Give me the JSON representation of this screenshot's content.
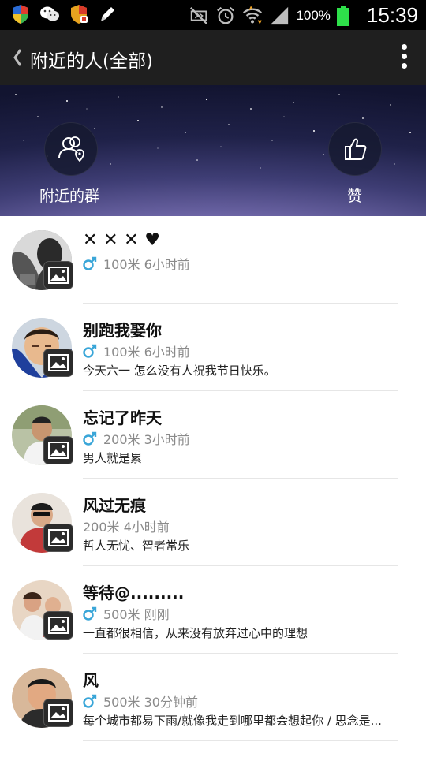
{
  "status_bar": {
    "battery_text": "100%",
    "time": "15:39",
    "left_icons": [
      "shield-icon",
      "wechat-icon",
      "shield-badge-icon",
      "pen-icon"
    ],
    "right_icons": [
      "mute-icon",
      "alarm-icon",
      "wifi-icon",
      "signal-icon",
      "battery-icon"
    ]
  },
  "action_bar": {
    "title": "附近的人(全部)"
  },
  "banner": {
    "left_button_label": "附近的群",
    "right_button_label": "赞"
  },
  "people": [
    {
      "name": "✕ ✕ ✕ ♥",
      "gender": "male",
      "distance_time": "100米 6小时前",
      "signature": ""
    },
    {
      "name": "别跑我娶你",
      "gender": "male",
      "distance_time": "100米 6小时前",
      "signature": "今天六一  怎么没有人祝我节日快乐。"
    },
    {
      "name": "忘记了昨天",
      "gender": "male",
      "distance_time": "200米 3小时前",
      "signature": "男人就是累"
    },
    {
      "name": "风过无痕",
      "gender": "",
      "distance_time": "200米 4小时前",
      "signature": "哲人无忧、智者常乐"
    },
    {
      "name": "等待@.........",
      "gender": "male",
      "distance_time": "500米 刚刚",
      "signature": "一直都很相信，从来没有放弃过心中的理想"
    },
    {
      "name": "风",
      "gender": "male",
      "distance_time": "500米 30分钟前",
      "signature": "每个城市都易下雨/就像我走到哪里都会想起你 / 思念是..."
    }
  ],
  "colors": {
    "action_bar_bg": "#1f1f1f",
    "status_bar_bg": "#000000",
    "male_icon": "#3aa6d8",
    "battery": "#2ee04a"
  }
}
